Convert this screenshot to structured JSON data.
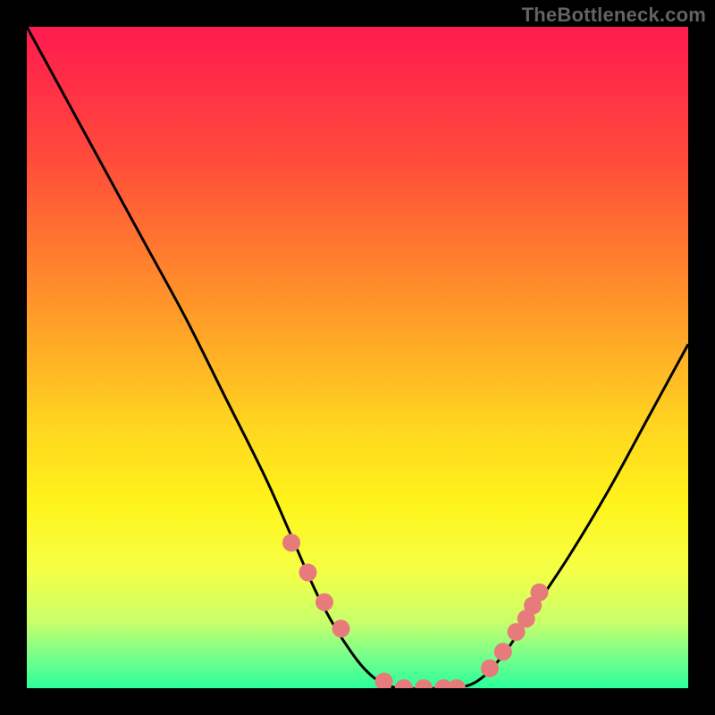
{
  "watermark": "TheBottleneck.com",
  "colors": {
    "bg": "#000000",
    "gradient_stops": [
      {
        "offset": 0.0,
        "color": "#ff1a50"
      },
      {
        "offset": 0.2,
        "color": "#ff4b3a"
      },
      {
        "offset": 0.4,
        "color": "#ff8f2a"
      },
      {
        "offset": 0.6,
        "color": "#ffd420"
      },
      {
        "offset": 0.72,
        "color": "#fff41a"
      },
      {
        "offset": 0.82,
        "color": "#f6ff45"
      },
      {
        "offset": 0.9,
        "color": "#c8ff6a"
      },
      {
        "offset": 0.95,
        "color": "#7aff8a"
      },
      {
        "offset": 1.0,
        "color": "#2bff9a"
      }
    ],
    "curve": "#000000",
    "marker": "#e77b7b"
  },
  "chart_data": {
    "type": "line",
    "title": "",
    "xlabel": "",
    "ylabel": "",
    "xlim": [
      0,
      100
    ],
    "ylim": [
      0,
      100
    ],
    "series": [
      {
        "name": "bottleneck-curve",
        "x": [
          0,
          6,
          12,
          18,
          24,
          30,
          36,
          40,
          44,
          48,
          52,
          56,
          60,
          64,
          68,
          72,
          76,
          82,
          88,
          94,
          100
        ],
        "y": [
          100,
          89,
          78,
          67,
          56,
          44,
          32,
          23,
          14,
          7,
          2,
          0,
          0,
          0,
          1,
          5,
          11,
          20,
          30,
          41,
          52
        ]
      }
    ],
    "markers": {
      "name": "highlight-points",
      "x": [
        40,
        42.5,
        45,
        47.5,
        54,
        57,
        60,
        63,
        65,
        70,
        72,
        74,
        75.5,
        76.5,
        77.5
      ],
      "y": [
        22,
        17.5,
        13,
        9,
        1,
        0,
        0,
        0,
        0,
        3,
        5.5,
        8.5,
        10.5,
        12.5,
        14.5
      ]
    }
  }
}
